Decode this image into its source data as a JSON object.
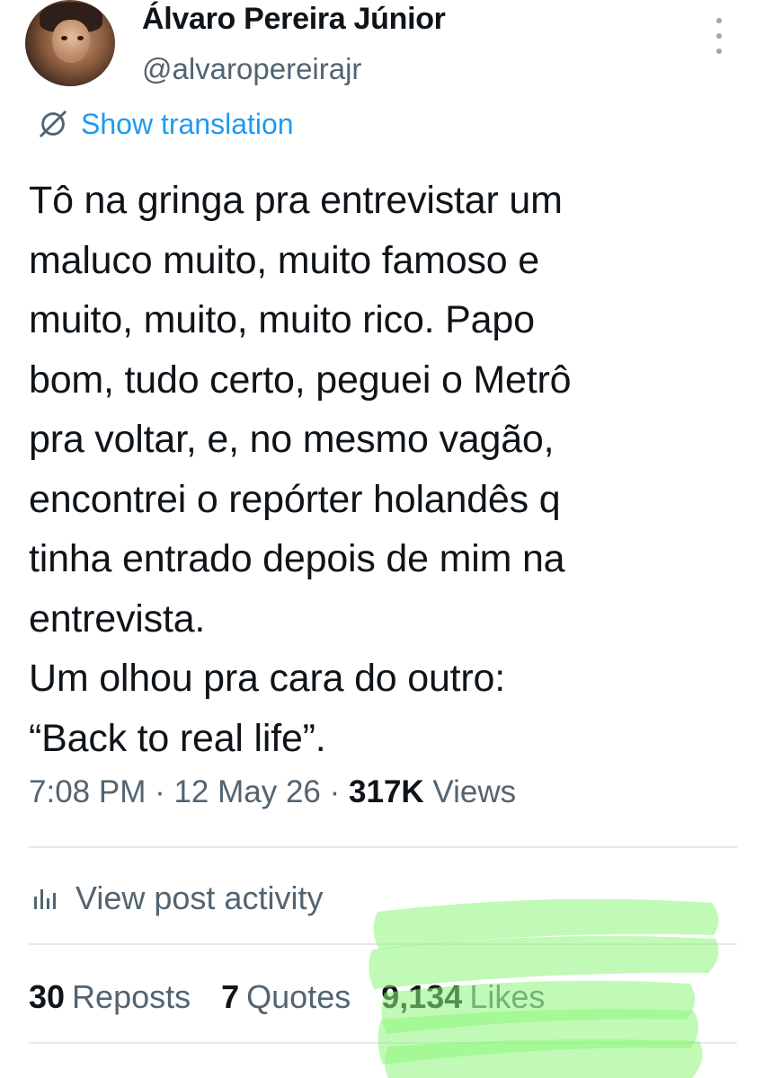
{
  "author": {
    "display_name": "Álvaro Pereira Júnior",
    "handle": "@alvaropereirajr"
  },
  "translate": {
    "label": "Show translation",
    "icon": "translate-icon"
  },
  "post": {
    "lines": [
      "Tô na gringa pra entrevistar um",
      "maluco muito, muito famoso e",
      "muito, muito, muito rico. Papo",
      "bom, tudo certo, peguei o Metrô",
      "pra voltar, e, no mesmo vagão,",
      "encontrei o repórter holandês q",
      "tinha entrado depois de mim na",
      "entrevista.",
      "Um olhou pra cara do outro:",
      "“Back to real life”."
    ]
  },
  "meta": {
    "time": "7:08 PM",
    "separator": " · ",
    "date": "12 May 26",
    "views_count": "317K",
    "views_label": "Views"
  },
  "activity": {
    "label": "View post activity",
    "icon": "bar-chart-icon"
  },
  "stats": {
    "reposts_count": "30",
    "reposts_label": "Reposts",
    "quotes_count": "7",
    "quotes_label": "Quotes",
    "likes_count": "9,134",
    "likes_label": "Likes"
  },
  "colors": {
    "link": "#1d9bf0",
    "secondary_text": "#536471",
    "highlight_marker": "#8cf57a"
  }
}
